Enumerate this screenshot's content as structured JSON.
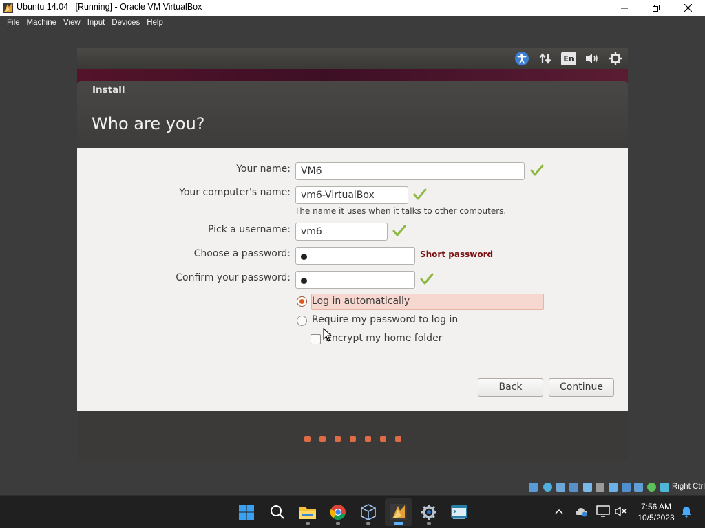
{
  "window": {
    "title": "Ubuntu 14.04   [Running] - Oracle VM VirtualBox",
    "app_icon": "virtualbox-vm-icon",
    "controls": [
      "minimize-icon",
      "maximize-icon",
      "close-icon"
    ]
  },
  "menubar": {
    "items": [
      "File",
      "Machine",
      "View",
      "Input",
      "Devices",
      "Help"
    ]
  },
  "ubuntu_panel": {
    "indicators": [
      "accessibility-icon",
      "network-arrows-icon",
      "keyboard-layout-indicator",
      "volume-icon",
      "settings-gear-icon"
    ],
    "keyboard_layout": "En"
  },
  "installer": {
    "window_title": "Install",
    "heading": "Who are you?",
    "fields": {
      "your_name": {
        "label": "Your name:",
        "value": "VM6",
        "status": "valid"
      },
      "computer_name": {
        "label": "Your computer's name:",
        "value": "vm6-VirtualBox",
        "status": "valid",
        "hint": "The name it uses when it talks to other computers."
      },
      "username": {
        "label": "Pick a username:",
        "value": "vm6",
        "status": "valid"
      },
      "password": {
        "label": "Choose a password:",
        "masked_chars": 1,
        "strength": "Short password"
      },
      "confirm_password": {
        "label": "Confirm your password:",
        "masked_chars": 1,
        "status": "valid"
      }
    },
    "login_options": [
      {
        "label": "Log in automatically",
        "selected": true
      },
      {
        "label": "Require my password to log in",
        "selected": false
      }
    ],
    "encrypt_home": {
      "label": "Encrypt my home folder",
      "checked": false
    },
    "buttons": {
      "back": "Back",
      "continue": "Continue"
    },
    "progress": {
      "steps": 7
    }
  },
  "vbox_statusbar": {
    "icons": [
      "hard-disk-icon",
      "optical-drive-icon",
      "audio-icon",
      "network-icon",
      "usb-icon",
      "shared-folders-icon",
      "display-icon",
      "recording-icon",
      "virtualization-icon",
      "mouse-integration-icon",
      "keyboard-capture-icon"
    ],
    "host_key": "Right Ctrl"
  },
  "taskbar": {
    "apps": [
      "windows-start-icon",
      "search-icon",
      "file-explorer-icon",
      "chrome-icon",
      "virtualbox-icon",
      "virtualbox-vm-icon",
      "settings-icon",
      "terminal-app-icon"
    ],
    "active_app": "virtualbox-vm-icon",
    "tray_icons": [
      "chevron-up-icon",
      "onedrive-icon",
      "display-monitor-icon",
      "speaker-muted-icon"
    ],
    "time": "7:56 AM",
    "date": "10/5/2023",
    "notification_icon": "notification-bell-icon"
  }
}
